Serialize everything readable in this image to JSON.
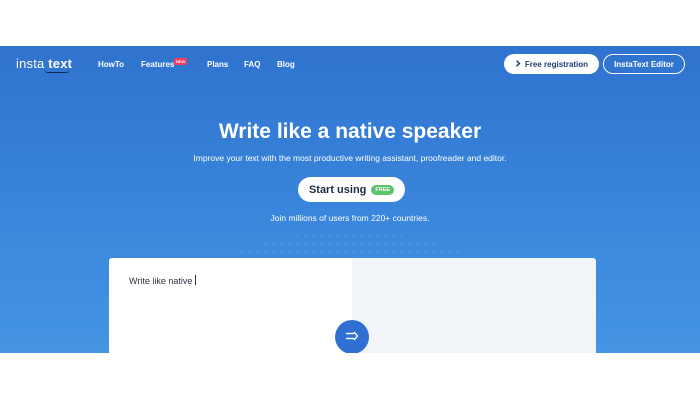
{
  "nav": {
    "logo_left": "insta",
    "logo_right": "text",
    "items": [
      {
        "label": "HowTo"
      },
      {
        "label": "Features",
        "badge": "NEW"
      },
      {
        "label": "Plans"
      },
      {
        "label": "FAQ"
      },
      {
        "label": "Blog"
      }
    ],
    "register_label": "Free registration",
    "editor_label": "InstaText Editor"
  },
  "hero": {
    "title": "Write like a native speaker",
    "subtitle": "Improve your text with the most productive writing assistant, proofreader and editor.",
    "cta_label": "Start using",
    "cta_badge": "FREE",
    "join_text": "Join millions of users from 220+ countries."
  },
  "editor": {
    "input_text": "Write like native"
  },
  "colors": {
    "hero_top": "#2f73cf",
    "hero_bottom": "#4595e3",
    "badge_new": "#ff3b5c",
    "badge_free": "#5cc46a",
    "convert_button": "#2f6fd1"
  }
}
